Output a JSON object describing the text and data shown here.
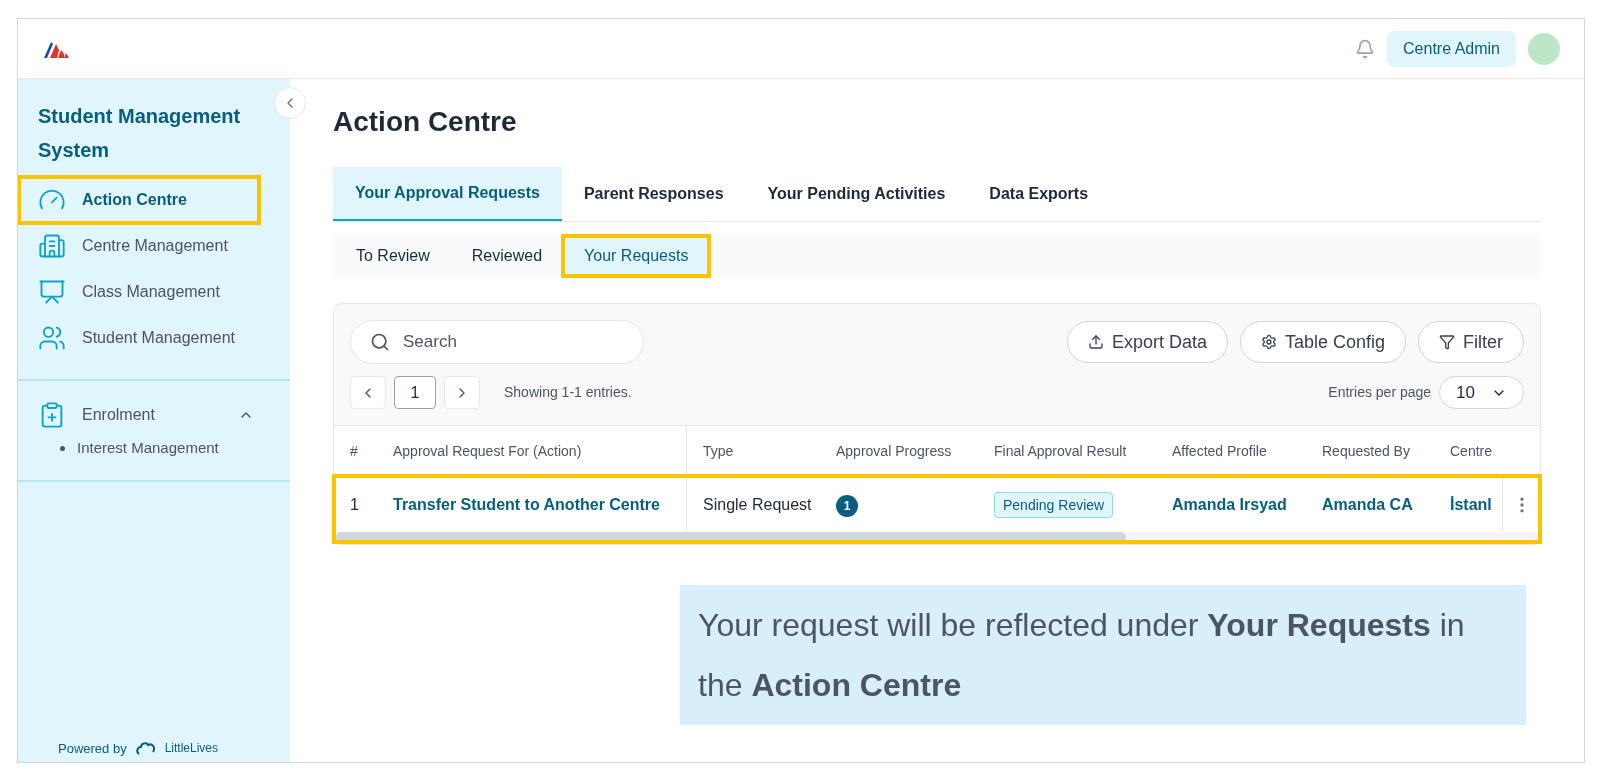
{
  "header": {
    "role": "Centre Admin"
  },
  "sidebar": {
    "title": "Student Management System",
    "items": [
      {
        "label": "Action Centre",
        "selected": true,
        "highlighted": true
      },
      {
        "label": "Centre Management",
        "selected": false,
        "highlighted": false
      },
      {
        "label": "Class Management",
        "selected": false,
        "highlighted": false
      },
      {
        "label": "Student Management",
        "selected": false,
        "highlighted": false
      }
    ],
    "group": {
      "label": "Enrolment",
      "expanded": true,
      "children": [
        {
          "label": "Interest Management"
        }
      ]
    },
    "powered_by": "Powered by",
    "brand": "LittleLives"
  },
  "page_title": "Action Centre",
  "tabs": [
    {
      "label": "Your Approval Requests",
      "selected": true
    },
    {
      "label": "Parent Responses",
      "selected": false
    },
    {
      "label": "Your Pending Activities",
      "selected": false
    },
    {
      "label": "Data Exports",
      "selected": false
    }
  ],
  "subtabs": [
    {
      "label": "To Review",
      "selected": false,
      "highlighted": false
    },
    {
      "label": "Reviewed",
      "selected": false,
      "highlighted": false
    },
    {
      "label": "Your Requests",
      "selected": true,
      "highlighted": true
    }
  ],
  "toolbar": {
    "search": {
      "placeholder": "Search"
    },
    "buttons": [
      {
        "label": "Export Data"
      },
      {
        "label": "Table Config"
      },
      {
        "label": "Filter"
      }
    ]
  },
  "pagination": {
    "page": "1",
    "summary": "Showing 1-1 entries.",
    "per_page_label": "Entries per page",
    "per_page": "10"
  },
  "table": {
    "columns": [
      "#",
      "Approval Request For (Action)",
      "Type",
      "Approval Progress",
      "Final Approval Result",
      "Affected Profile",
      "Requested By",
      "Centre"
    ],
    "rows": [
      {
        "highlighted": true,
        "number": "1",
        "action": "Transfer Student to Another Centre",
        "type": "Single Request",
        "progress": "1",
        "result": "Pending Review",
        "profile": "Amanda Irsyad",
        "requested_by": "Amanda CA",
        "centre": "İstanl"
      }
    ]
  },
  "caption": "Your request will be reflected under **Your Requests** in the **Action Centre**"
}
